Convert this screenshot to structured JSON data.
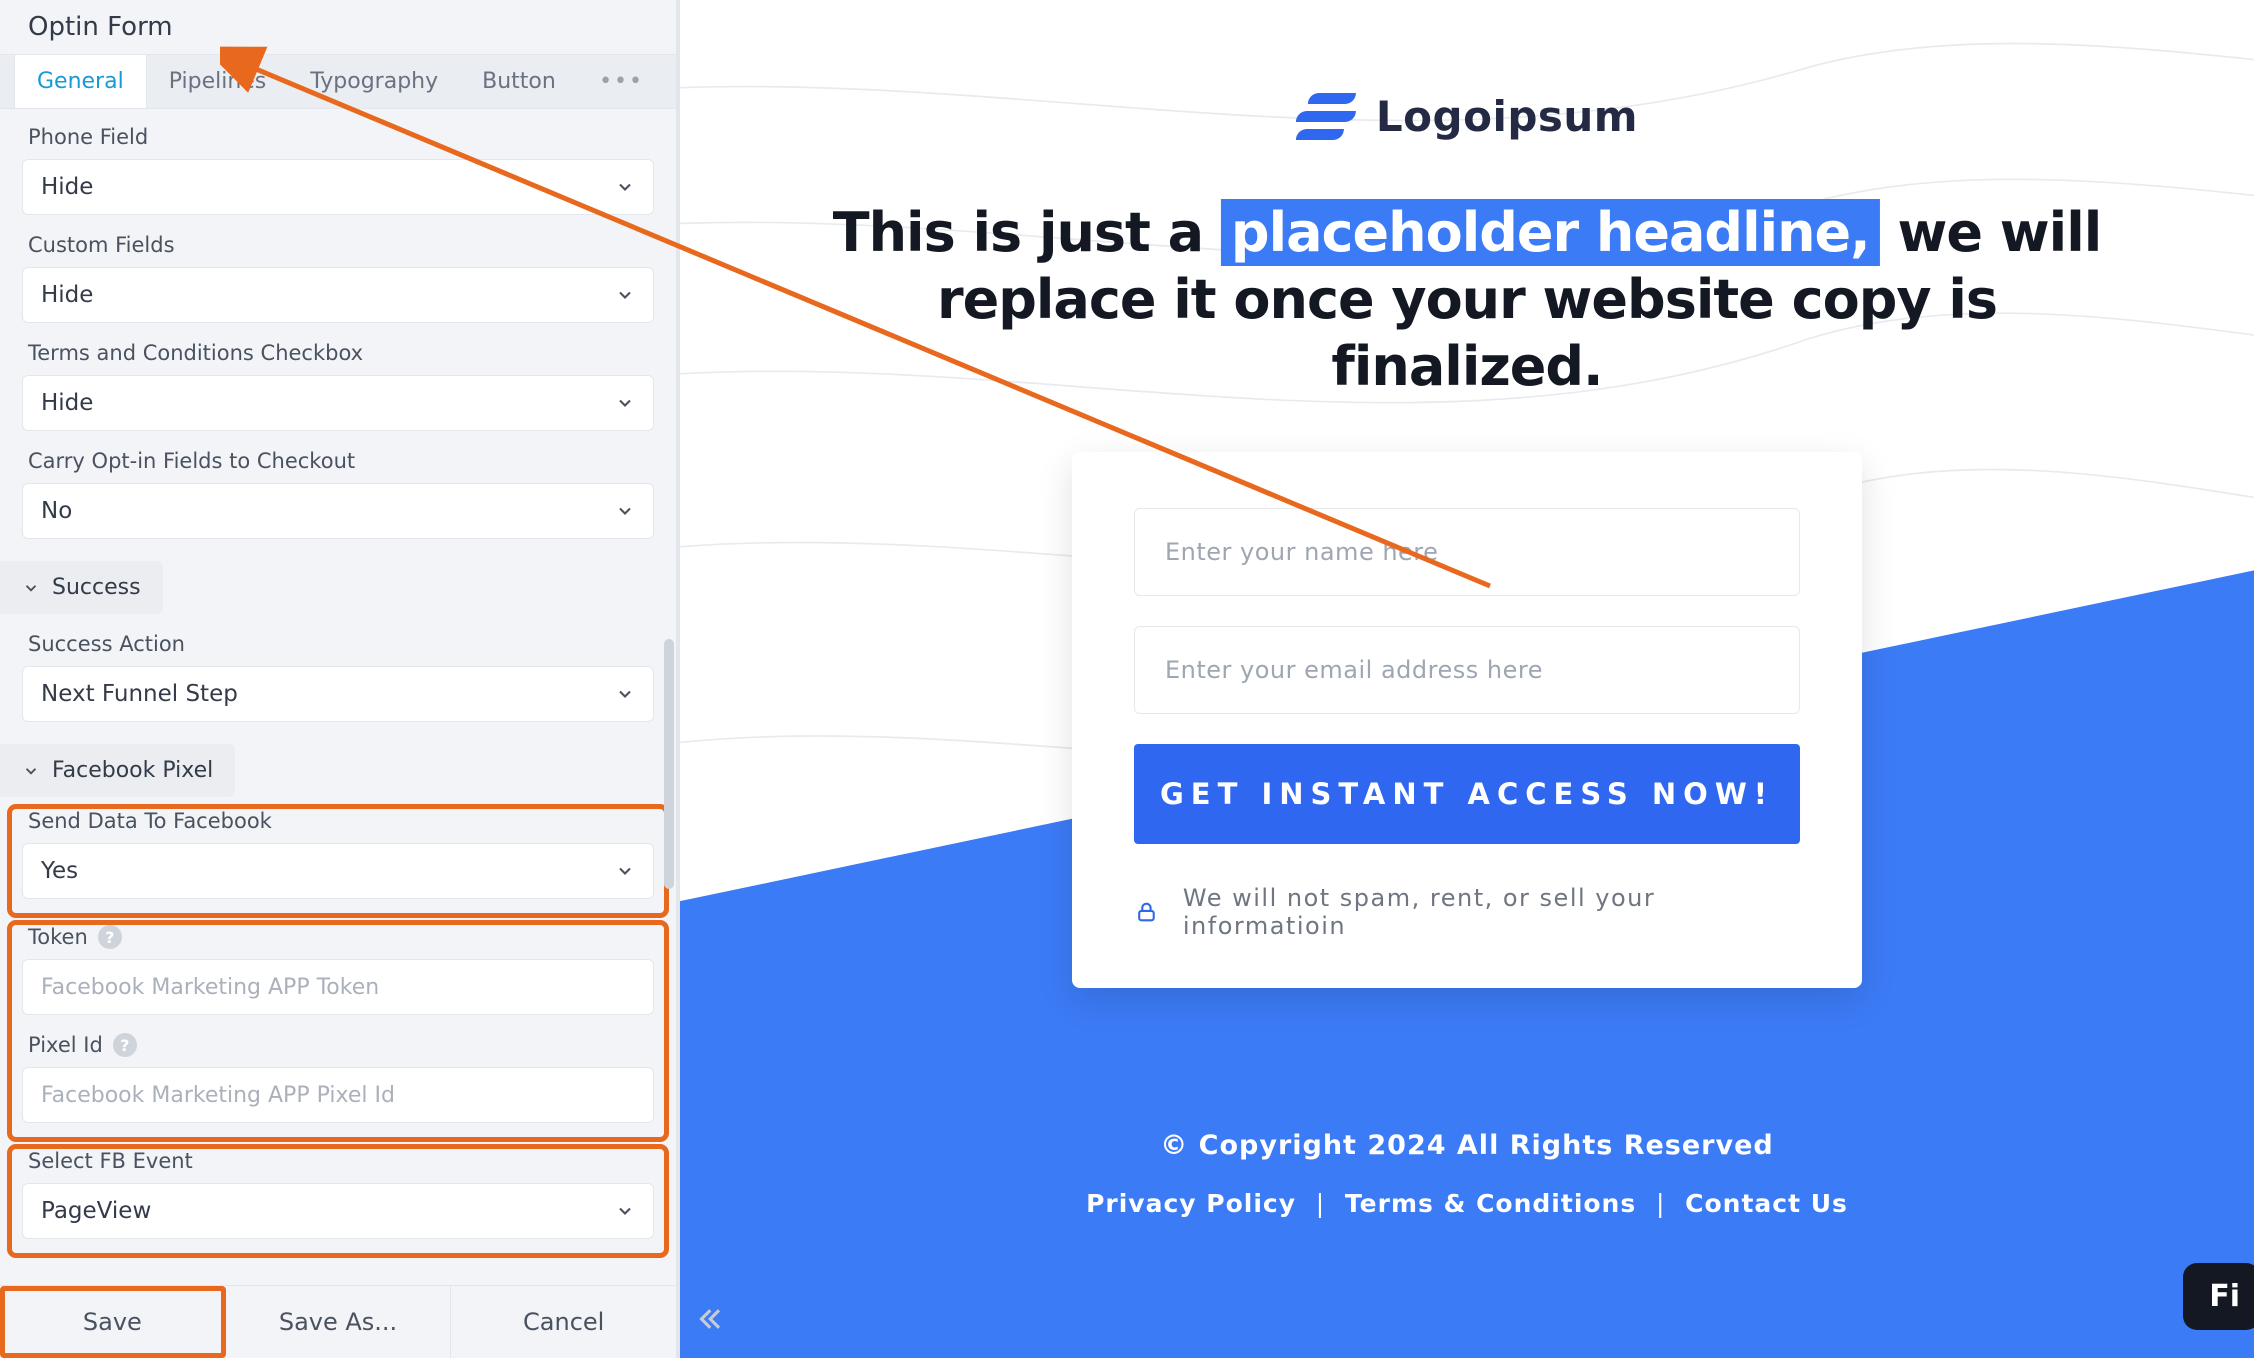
{
  "sidebar": {
    "title": "Optin Form",
    "tabs": {
      "general": "General",
      "pipelines": "Pipelines",
      "typography": "Typography",
      "button": "Button"
    },
    "labels": {
      "phone_field": "Phone Field",
      "custom_fields": "Custom Fields",
      "terms": "Terms and Conditions Checkbox",
      "carry": "Carry Opt-in Fields to Checkout",
      "success_action": "Success Action",
      "send_fb": "Send Data To Facebook",
      "token": "Token",
      "pixel_id": "Pixel Id",
      "select_fb_event": "Select FB Event"
    },
    "sections": {
      "success": "Success",
      "facebook_pixel": "Facebook Pixel"
    },
    "values": {
      "phone_field": "Hide",
      "custom_fields": "Hide",
      "terms": "Hide",
      "carry": "No",
      "success_action": "Next Funnel Step",
      "send_fb": "Yes",
      "select_fb_event": "PageView"
    },
    "placeholders": {
      "token": "Facebook Marketing APP Token",
      "pixel_id": "Facebook Marketing APP Pixel Id"
    },
    "footer": {
      "save": "Save",
      "save_as": "Save As...",
      "cancel": "Cancel"
    }
  },
  "canvas": {
    "logo_text": "Logoipsum",
    "headline_pre": "This is just a ",
    "headline_hl": "placeholder headline,",
    "headline_post": " we will replace it once your website copy is finalized.",
    "name_placeholder": "Enter your name here",
    "email_placeholder": "Enter your email address here",
    "cta": "GET INSTANT ACCESS NOW!",
    "disclaimer": "We will not spam, rent, or sell your informatioin",
    "copyright": "© Copyright 2024 All Rights Reserved",
    "footer_links": {
      "privacy": "Privacy Policy",
      "terms": "Terms & Conditions",
      "contact": "Contact Us"
    }
  },
  "floating": {
    "fi": "Fi"
  }
}
